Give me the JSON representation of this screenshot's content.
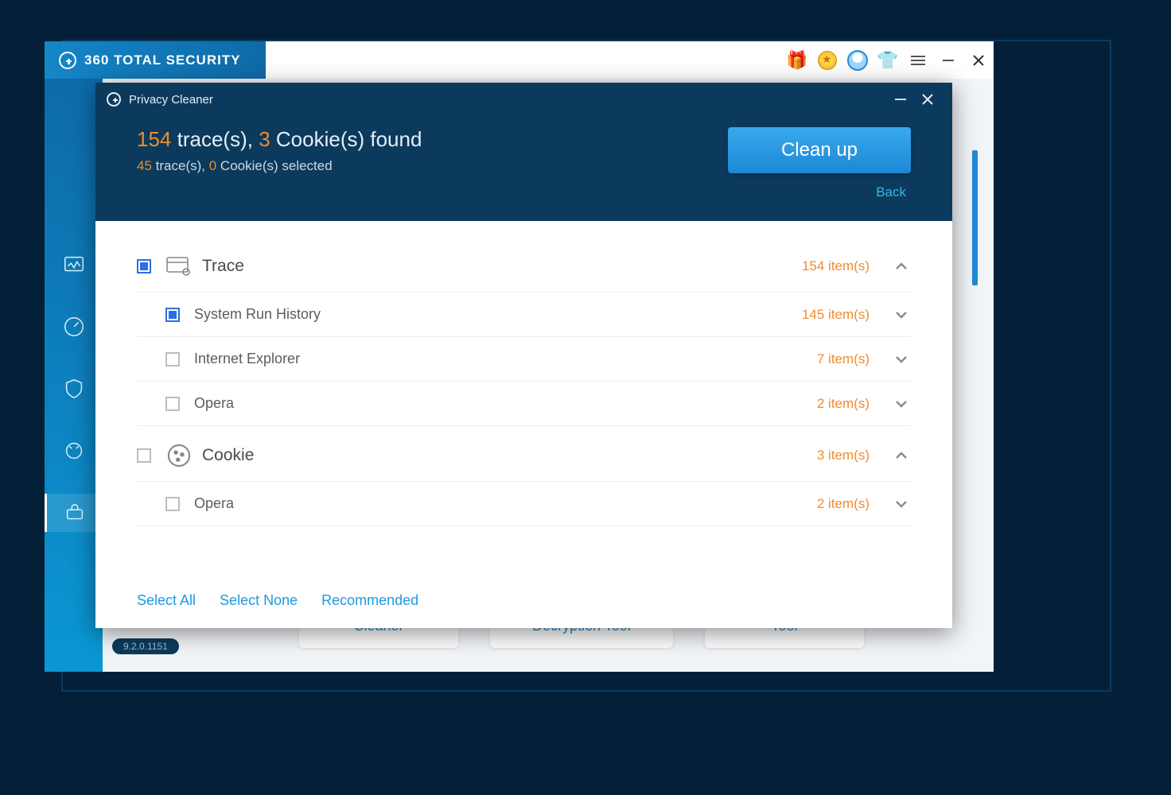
{
  "app": {
    "brand": "360 TOTAL SECURITY",
    "version": "9.2.0.1151"
  },
  "bg_tools": {
    "cleaner": "Cleaner",
    "decryption": "Decryption Tool",
    "tool": "Tool"
  },
  "modal": {
    "title": "Privacy Cleaner",
    "summary": {
      "traces_count": "154",
      "traces_label": " trace(s), ",
      "cookies_count": "3",
      "cookies_label": " Cookie(s) found",
      "sel_traces": "45",
      "sel_traces_label": " trace(s), ",
      "sel_cookies": "0",
      "sel_cookies_label": " Cookie(s) selected"
    },
    "cleanup_label": "Clean up",
    "back_label": "Back",
    "groups": [
      {
        "name": "Trace",
        "count": "154 item(s)",
        "items": [
          {
            "name": "System Run History",
            "count": "145 item(s)"
          },
          {
            "name": "Internet Explorer",
            "count": "7 item(s)"
          },
          {
            "name": "Opera",
            "count": "2 item(s)"
          }
        ]
      },
      {
        "name": "Cookie",
        "count": "3 item(s)",
        "items": [
          {
            "name": "Opera",
            "count": "2 item(s)"
          }
        ]
      }
    ],
    "footer": {
      "select_all": "Select All",
      "select_none": "Select None",
      "recommended": "Recommended"
    }
  }
}
